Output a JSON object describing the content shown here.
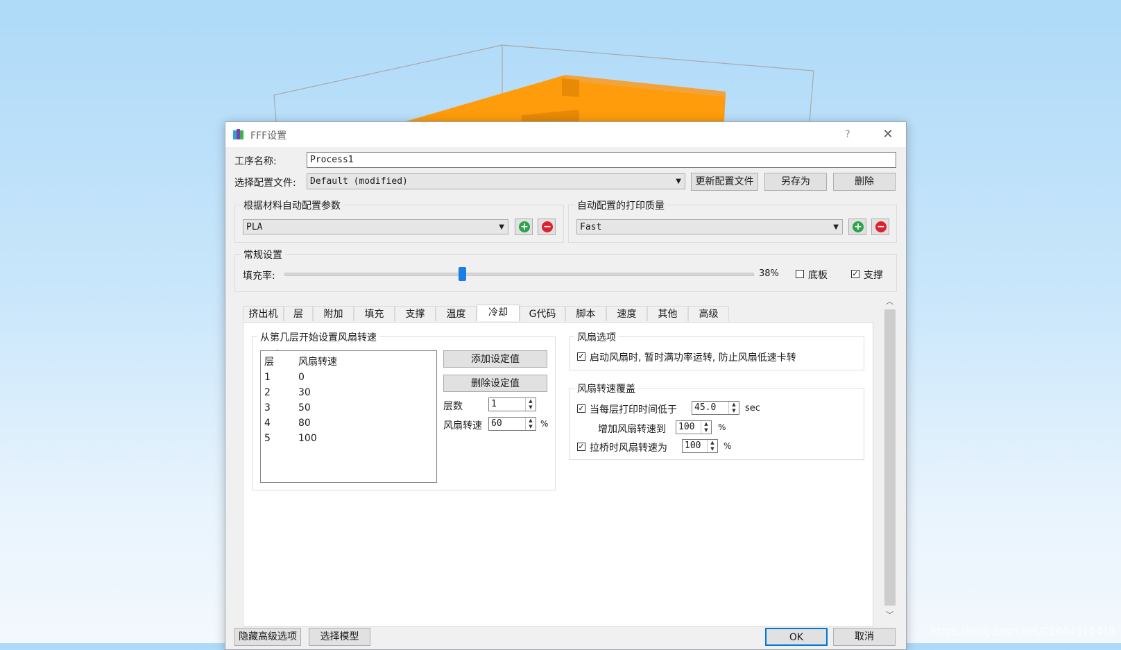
{
  "dialog": {
    "title": "FFF设置",
    "help": "?",
    "close": "✕"
  },
  "process": {
    "name_label": "工序名称:",
    "name_value": "Process1",
    "profile_label": "选择配置文件:",
    "profile_value": "Default (modified)",
    "update_btn": "更新配置文件",
    "saveas_btn": "另存为",
    "delete_btn": "删除"
  },
  "material_group": {
    "title": "根据材料自动配置参数",
    "value": "PLA"
  },
  "quality_group": {
    "title": "自动配置的打印质量",
    "value": "Fast"
  },
  "general": {
    "title": "常规设置",
    "infill_label": "填充率:",
    "infill_value": "38%",
    "infill_fraction": 0.38,
    "raft_label": "底板",
    "raft_checked": false,
    "support_label": "支撑",
    "support_checked": true
  },
  "tabs": [
    "挤出机",
    "层",
    "附加",
    "填充",
    "支撑",
    "温度",
    "冷却",
    "G代码",
    "脚本",
    "速度",
    "其他",
    "高级"
  ],
  "active_tab": "冷却",
  "fan_layers": {
    "title": "从第几层开始设置风扇转速",
    "col_layer": "层",
    "col_speed": "风扇转速",
    "rows": [
      {
        "layer": "1",
        "speed": "0"
      },
      {
        "layer": "2",
        "speed": "30"
      },
      {
        "layer": "3",
        "speed": "50"
      },
      {
        "layer": "4",
        "speed": "80"
      },
      {
        "layer": "5",
        "speed": "100"
      }
    ],
    "add_btn": "添加设定值",
    "remove_btn": "删除设定值",
    "layer_label": "层数",
    "layer_value": "1",
    "speed_label": "风扇转速",
    "speed_value": "60",
    "percent": "%"
  },
  "fan_options": {
    "title": "风扇选项",
    "kick_label": "启动风扇时, 暂时满功率运转, 防止风扇低速卡转",
    "kick_checked": true
  },
  "fan_override": {
    "title": "风扇转速覆盖",
    "time_label": "当每层打印时间低于",
    "time_value": "45.0",
    "time_unit": "sec",
    "time_checked": true,
    "increase_label": "增加风扇转速到",
    "increase_value": "100",
    "increase_unit": "%",
    "bridge_label": "拉桥时风扇转速为",
    "bridge_value": "100",
    "bridge_unit": "%",
    "bridge_checked": true
  },
  "footer": {
    "hide_advanced": "隐藏高级选项",
    "select_model": "选择模型",
    "ok": "OK",
    "cancel": "取消"
  },
  "watermark": "https://blog.csdn.net/C1664510416",
  "colors": {
    "model": "#ff9c0c",
    "accent": "#1a7ee6",
    "plus": "#2da24a",
    "minus": "#e0202e"
  }
}
